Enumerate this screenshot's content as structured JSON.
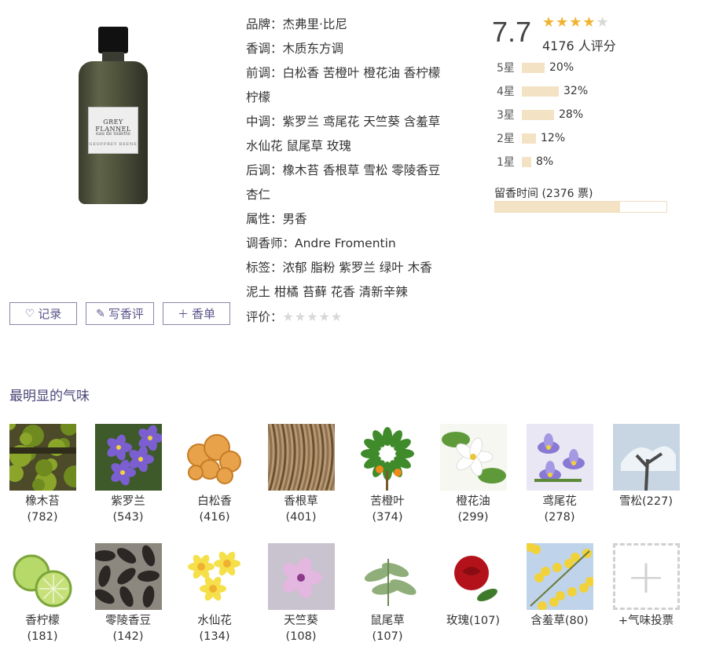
{
  "product": {
    "label_title": "GREY FLANNEL",
    "label_sub": "eau de toilette",
    "label_maker": "GEOFFREY BEENE"
  },
  "actions": {
    "record": "记录",
    "review": "写香评",
    "list": "香单"
  },
  "info": {
    "brand": "品牌：杰弗里·比尼",
    "family": "香调：木质东方调",
    "top_1": "前调：白松香 苦橙叶 橙花油 香柠檬",
    "top_2": "柠檬",
    "heart_1": "中调：紫罗兰 鸢尾花 天竺葵 含羞草",
    "heart_2": "水仙花 鼠尾草 玫瑰",
    "base_1": "后调：橡木苔 香根草 雪松 零陵香豆",
    "base_2": "杏仁",
    "gender": "属性：男香",
    "perfumer": "调香师：Andre Fromentin",
    "tags_1": "标签：浓郁 脂粉 紫罗兰 绿叶 木香",
    "tags_2": "泥土 柑橘 苔藓 花香 清新辛辣",
    "rate_label": "评价："
  },
  "rating": {
    "score": "7.7",
    "stars": 4,
    "votes": "4176 人评分",
    "distribution": [
      {
        "label": "5星",
        "pct": "20%",
        "value": 20
      },
      {
        "label": "4星",
        "pct": "32%",
        "value": 32
      },
      {
        "label": "3星",
        "pct": "28%",
        "value": 28
      },
      {
        "label": "2星",
        "pct": "12%",
        "value": 12
      },
      {
        "label": "1星",
        "pct": "8%",
        "value": 8
      }
    ],
    "longevity_label": "留香时间 (2376 票)",
    "longevity_fraction": 0.73
  },
  "section_title": "最明显的气味",
  "notes": [
    {
      "name": "橡木苔",
      "count": "(782)",
      "icon": "oakmoss"
    },
    {
      "name": "紫罗兰",
      "count": "(543)",
      "icon": "violet"
    },
    {
      "name": "白松香",
      "count": "(416)",
      "icon": "galbanum"
    },
    {
      "name": "香根草",
      "count": "(401)",
      "icon": "vetiver"
    },
    {
      "name": "苦橙叶",
      "count": "(374)",
      "icon": "petitgrain"
    },
    {
      "name": "橙花油",
      "count": "(299)",
      "icon": "neroli"
    },
    {
      "name": "鸢尾花",
      "count": "(278)",
      "icon": "iris"
    },
    {
      "name": "雪松(227)",
      "count": "",
      "icon": "cedar"
    },
    {
      "name": "香柠檬",
      "count": "(181)",
      "icon": "bergamot"
    },
    {
      "name": "零陵香豆",
      "count": "(142)",
      "icon": "tonka"
    },
    {
      "name": "水仙花",
      "count": "(134)",
      "icon": "narcissus"
    },
    {
      "name": "天竺葵",
      "count": "(108)",
      "icon": "geranium"
    },
    {
      "name": "鼠尾草",
      "count": "(107)",
      "icon": "sage"
    },
    {
      "name": "玫瑰(107)",
      "count": "",
      "icon": "rose"
    },
    {
      "name": "含羞草(80)",
      "count": "",
      "icon": "mimosa"
    }
  ],
  "add_note": "+气味投票",
  "colors": {
    "accent": "#5b568a",
    "star": "#f0b432",
    "bar": "#f4e2c4"
  }
}
